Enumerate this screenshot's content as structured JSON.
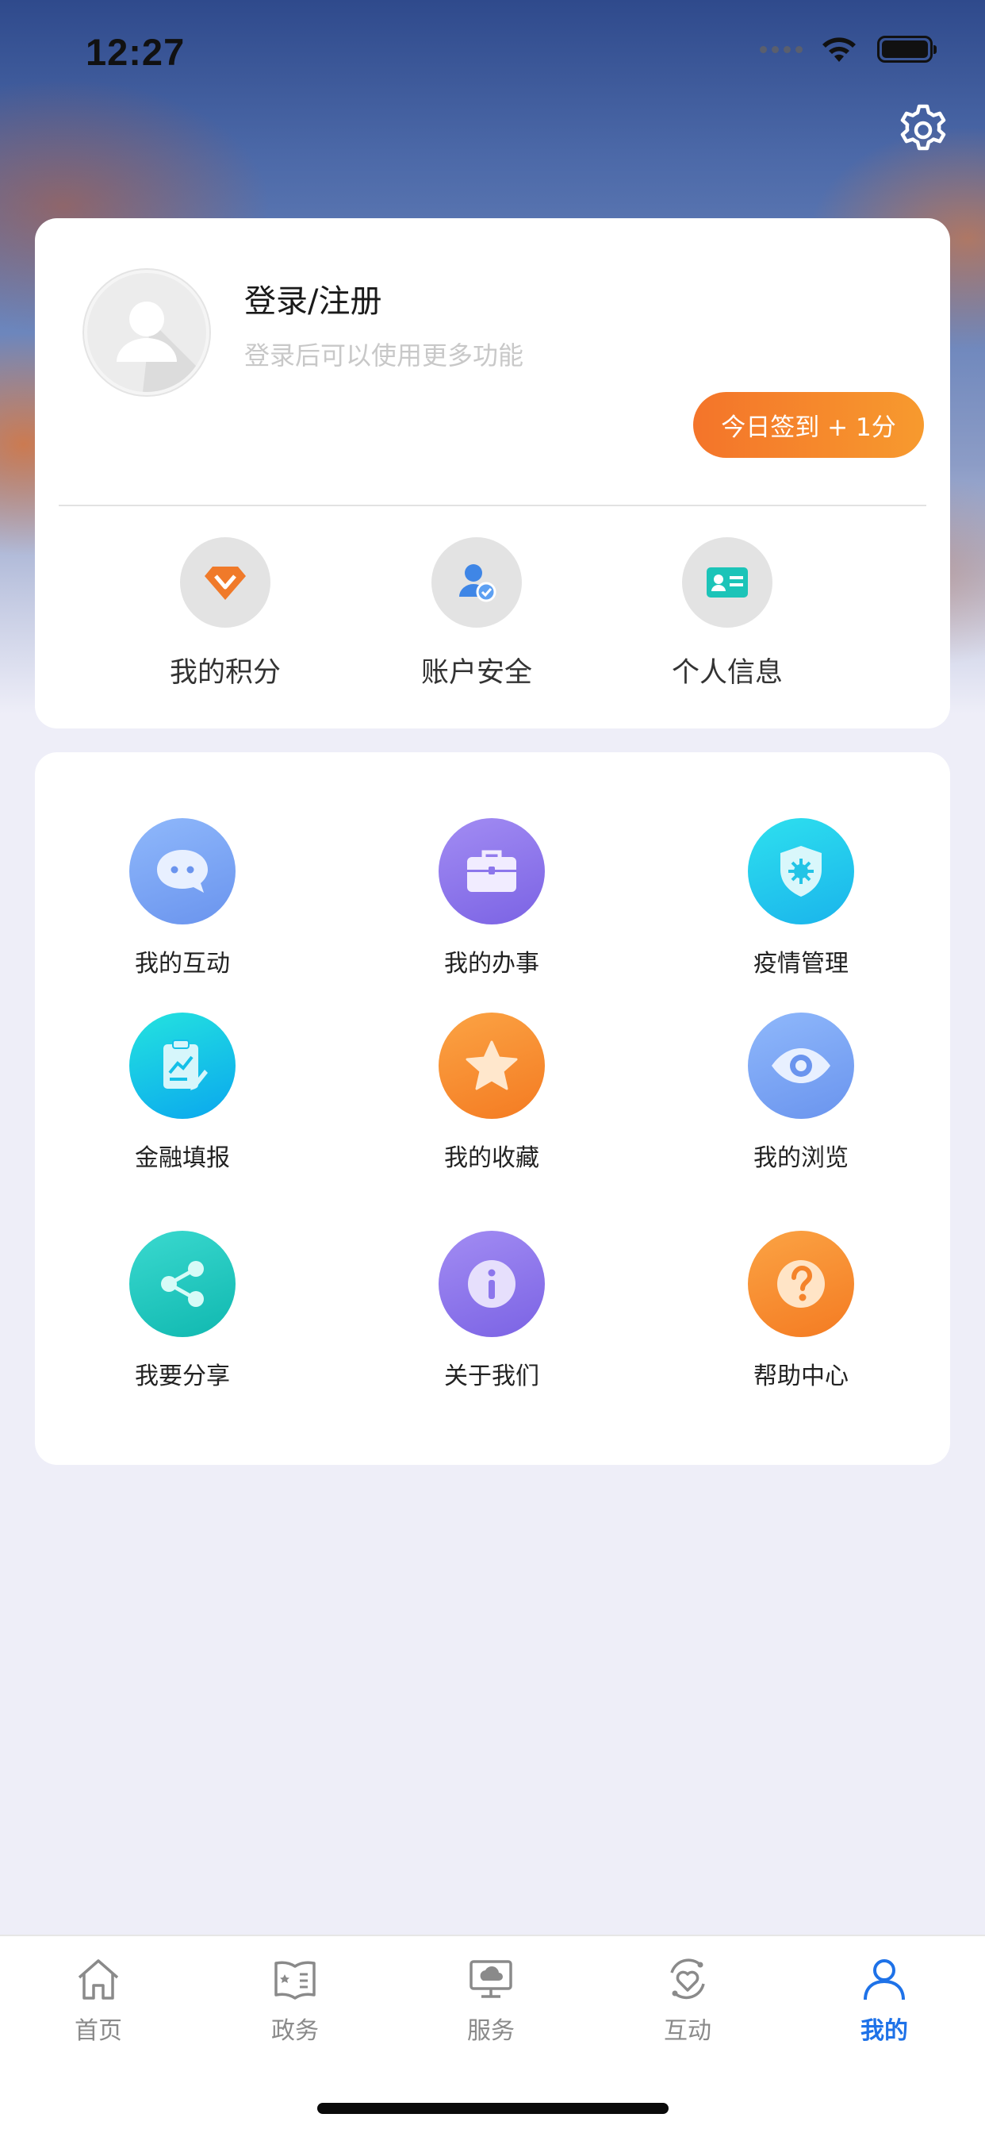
{
  "status_bar": {
    "time": "12:27"
  },
  "profile": {
    "title": "登录/注册",
    "subtitle": "登录后可以使用更多功能",
    "signin_button": "今日签到 + 1分"
  },
  "quick_links": [
    {
      "label": "我的积分",
      "icon": "diamond-icon"
    },
    {
      "label": "账户安全",
      "icon": "user-shield-icon"
    },
    {
      "label": "个人信息",
      "icon": "id-card-icon"
    }
  ],
  "menu": [
    {
      "label": "我的互动",
      "icon": "chat-bubble-icon",
      "color": "#7aa6f5"
    },
    {
      "label": "我的办事",
      "icon": "briefcase-icon",
      "color": "#8c76ec"
    },
    {
      "label": "疫情管理",
      "icon": "shield-virus-icon",
      "color": "#22d0e8"
    },
    {
      "label": "金融填报",
      "icon": "clipboard-chart-icon",
      "color": "#12c6e8"
    },
    {
      "label": "我的收藏",
      "icon": "star-icon",
      "color": "#f7902e"
    },
    {
      "label": "我的浏览",
      "icon": "eye-icon",
      "color": "#7aa6f5"
    },
    {
      "label": "我要分享",
      "icon": "share-icon",
      "color": "#1ec8c0"
    },
    {
      "label": "关于我们",
      "icon": "info-icon",
      "color": "#8c76ec"
    },
    {
      "label": "帮助中心",
      "icon": "question-icon",
      "color": "#f7902e"
    }
  ],
  "tabs": [
    {
      "label": "首页",
      "icon": "home-icon",
      "active": false
    },
    {
      "label": "政务",
      "icon": "government-book-icon",
      "active": false
    },
    {
      "label": "服务",
      "icon": "service-monitor-icon",
      "active": false
    },
    {
      "label": "互动",
      "icon": "heart-interaction-icon",
      "active": false
    },
    {
      "label": "我的",
      "icon": "user-icon",
      "active": true
    }
  ],
  "colors": {
    "accent": "#1e72e8",
    "signin_gradient_start": "#f4742a",
    "signin_gradient_end": "#f79a2e",
    "page_background": "#eeeef8"
  }
}
